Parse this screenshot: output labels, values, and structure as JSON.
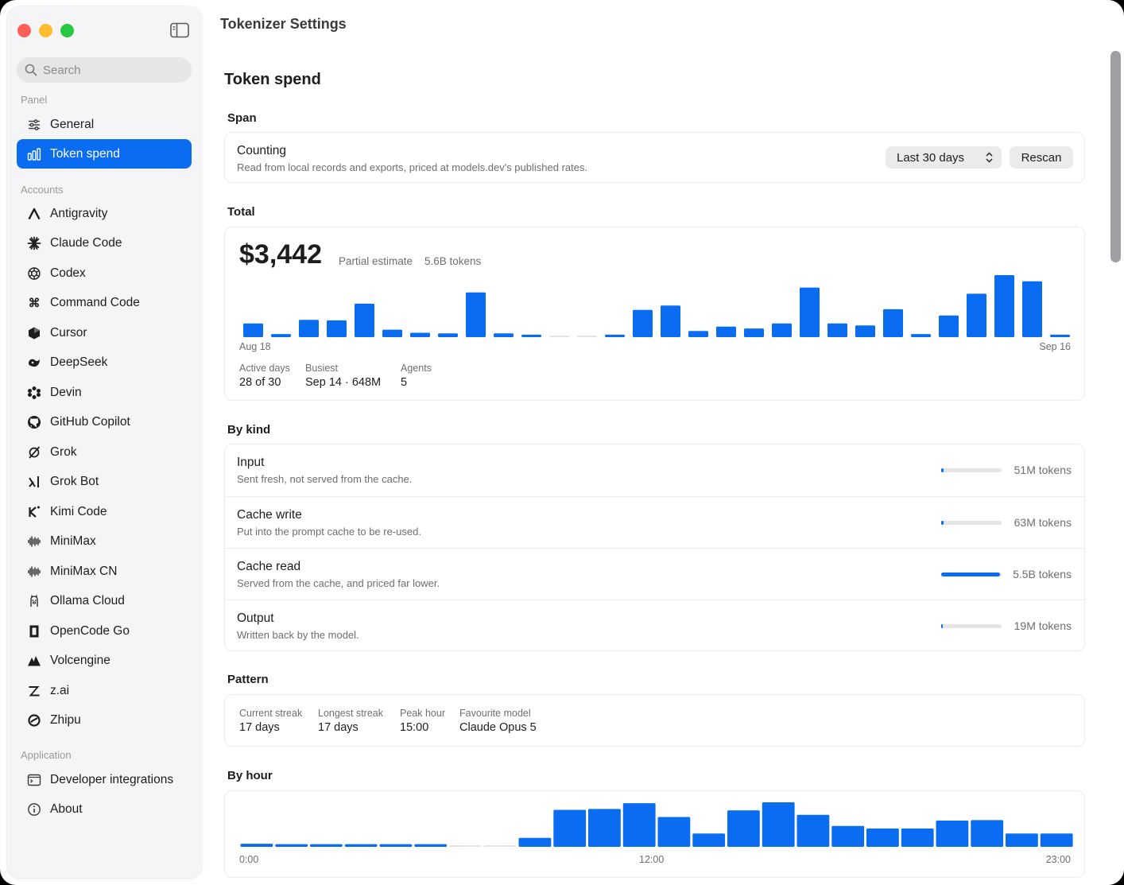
{
  "window": {
    "title": "Tokenizer Settings"
  },
  "search": {
    "placeholder": "Search"
  },
  "sidebar": {
    "panel_label": "Panel",
    "panel_items": [
      {
        "label": "General",
        "icon": "sliders-icon"
      },
      {
        "label": "Token spend",
        "icon": "bar-chart-icon",
        "active": true
      }
    ],
    "accounts_label": "Accounts",
    "accounts": [
      {
        "label": "Antigravity",
        "icon": "antigravity-icon"
      },
      {
        "label": "Claude Code",
        "icon": "claude-icon"
      },
      {
        "label": "Codex",
        "icon": "openai-icon"
      },
      {
        "label": "Command Code",
        "icon": "command-icon"
      },
      {
        "label": "Cursor",
        "icon": "cube-icon"
      },
      {
        "label": "DeepSeek",
        "icon": "deepseek-icon"
      },
      {
        "label": "Devin",
        "icon": "devin-icon"
      },
      {
        "label": "GitHub Copilot",
        "icon": "github-icon"
      },
      {
        "label": "Grok",
        "icon": "grok-icon"
      },
      {
        "label": "Grok Bot",
        "icon": "xai-icon"
      },
      {
        "label": "Kimi Code",
        "icon": "kimi-icon"
      },
      {
        "label": "MiniMax",
        "icon": "waveform-icon"
      },
      {
        "label": "MiniMax CN",
        "icon": "waveform-icon"
      },
      {
        "label": "Ollama Cloud",
        "icon": "ollama-icon"
      },
      {
        "label": "OpenCode Go",
        "icon": "opencode-icon"
      },
      {
        "label": "Volcengine",
        "icon": "mountain-icon"
      },
      {
        "label": "z.ai",
        "icon": "z-icon"
      },
      {
        "label": "Zhipu",
        "icon": "zhipu-icon"
      }
    ],
    "application_label": "Application",
    "application_items": [
      {
        "label": "Developer integrations",
        "icon": "terminal-icon"
      },
      {
        "label": "About",
        "icon": "info-icon"
      }
    ]
  },
  "page": {
    "title": "Token spend",
    "span": {
      "heading": "Span",
      "title": "Counting",
      "subtitle": "Read from local records and exports, priced at models.dev's published rates.",
      "range_value": "Last 30 days",
      "rescan_label": "Rescan"
    },
    "total": {
      "heading": "Total",
      "amount": "$3,442",
      "estimate_label": "Partial estimate",
      "tokens": "5.6B tokens",
      "x_start": "Aug 18",
      "x_end": "Sep 16",
      "stats": [
        {
          "label": "Active days",
          "value": "28 of 30"
        },
        {
          "label": "Busiest",
          "value": "Sep 14 · 648M"
        },
        {
          "label": "Agents",
          "value": "5"
        }
      ]
    },
    "by_kind": {
      "heading": "By kind",
      "rows": [
        {
          "title": "Input",
          "subtitle": "Sent fresh, not served from the cache.",
          "value": "51M tokens",
          "fraction": 0.04
        },
        {
          "title": "Cache write",
          "subtitle": "Put into the prompt cache to be re-used.",
          "value": "63M tokens",
          "fraction": 0.04
        },
        {
          "title": "Cache read",
          "subtitle": "Served from the cache, and priced far lower.",
          "value": "5.5B tokens",
          "fraction": 0.97
        },
        {
          "title": "Output",
          "subtitle": "Written back by the model.",
          "value": "19M tokens",
          "fraction": 0.03
        }
      ]
    },
    "pattern": {
      "heading": "Pattern",
      "stats": [
        {
          "label": "Current streak",
          "value": "17 days"
        },
        {
          "label": "Longest streak",
          "value": "17 days"
        },
        {
          "label": "Peak hour",
          "value": "15:00"
        },
        {
          "label": "Favourite model",
          "value": "Claude Opus 5"
        }
      ]
    },
    "by_hour": {
      "heading": "By hour",
      "x_labels": [
        "0:00",
        "12:00",
        "23:00"
      ]
    }
  },
  "chart_data": [
    {
      "type": "bar",
      "title": "",
      "categories": [
        "Aug 18",
        "Aug 19",
        "Aug 20",
        "Aug 21",
        "Aug 22",
        "Aug 23",
        "Aug 24",
        "Aug 25",
        "Aug 26",
        "Aug 27",
        "Aug 28",
        "Aug 29",
        "Aug 30",
        "Aug 31",
        "Sep 1",
        "Sep 2",
        "Sep 3",
        "Sep 4",
        "Sep 5",
        "Sep 6",
        "Sep 7",
        "Sep 8",
        "Sep 9",
        "Sep 10",
        "Sep 11",
        "Sep 12",
        "Sep 13",
        "Sep 14",
        "Sep 15",
        "Sep 16"
      ],
      "values": [
        0.22,
        0.05,
        0.28,
        0.27,
        0.54,
        0.12,
        0.07,
        0.06,
        0.72,
        0.06,
        0.04,
        0.0,
        0.0,
        0.04,
        0.44,
        0.51,
        0.1,
        0.17,
        0.14,
        0.22,
        0.8,
        0.22,
        0.19,
        0.45,
        0.05,
        0.35,
        0.7,
        1.0,
        0.9,
        0.04
      ],
      "unit": "relative",
      "accent": "#0a6cf0"
    },
    {
      "type": "bar",
      "title": "",
      "categories": [
        "0",
        "1",
        "2",
        "3",
        "4",
        "5",
        "6",
        "7",
        "8",
        "9",
        "10",
        "11",
        "12",
        "13",
        "14",
        "15",
        "16",
        "17",
        "18",
        "19",
        "20",
        "21",
        "22",
        "23"
      ],
      "values": [
        0.07,
        0.06,
        0.06,
        0.06,
        0.06,
        0.06,
        0.0,
        0.0,
        0.2,
        0.83,
        0.85,
        0.98,
        0.67,
        0.3,
        0.82,
        1.0,
        0.72,
        0.47,
        0.41,
        0.41,
        0.59,
        0.6,
        0.3,
        0.3
      ],
      "unit": "relative",
      "accent": "#0a6cf0"
    }
  ]
}
